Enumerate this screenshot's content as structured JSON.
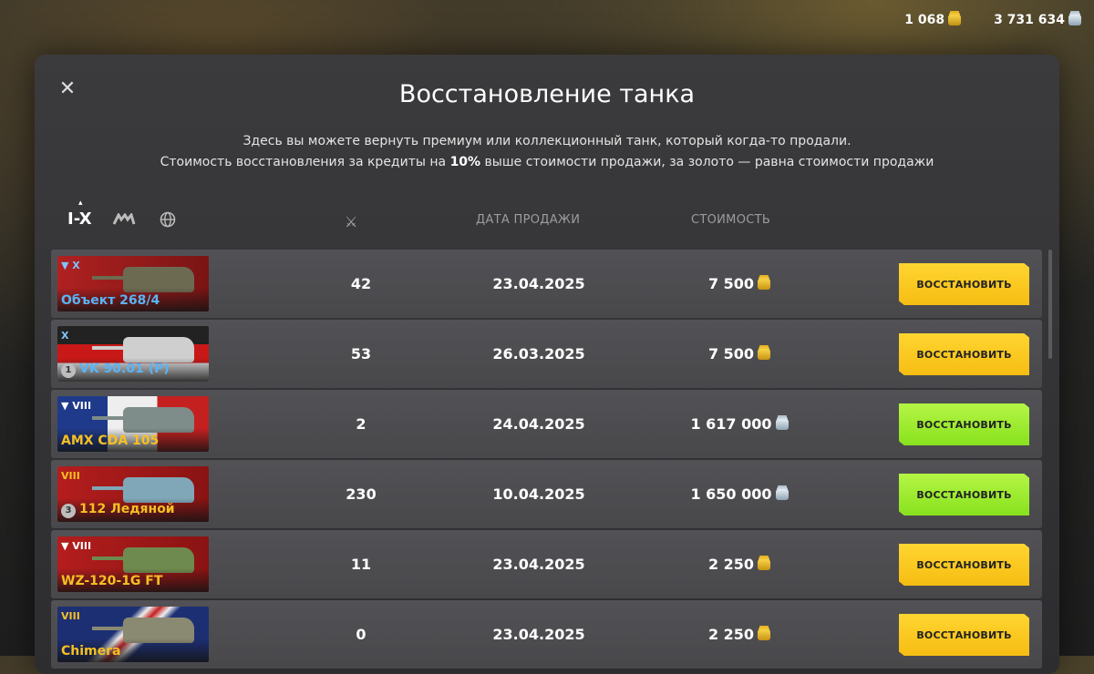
{
  "currency": {
    "gold": "1 068",
    "credits": "3 731 634"
  },
  "dialog": {
    "title": "Восстановление танка",
    "subtitle_line1": "Здесь вы можете вернуть премиум или коллекционный танк, который когда-то продали.",
    "subtitle_line2_pre": "Стоимость восстановления за кредиты на ",
    "subtitle_line2_bold": "10%",
    "subtitle_line2_post": " выше стоимости продажи, за золото — равна стоимости продажи"
  },
  "filters": {
    "tier_label": "I-X"
  },
  "columns": {
    "date": "ДАТА ПРОДАЖИ",
    "price": "СТОИМОСТЬ"
  },
  "colors": {
    "gold_button": "#f6bd12",
    "green_button": "#88e21e",
    "premium_name": "#f5c022",
    "collector_name": "#59b4f6"
  },
  "rows": [
    {
      "tier": "▼ X",
      "name": "Объект 268/4",
      "battles": "42",
      "date": "23.04.2025",
      "price": "7 500",
      "currency": "gold",
      "button": "ВОССТАНОВИТЬ"
    },
    {
      "tier": "X",
      "mastery": "1",
      "name": "VK 90.01 (P)",
      "battles": "53",
      "date": "26.03.2025",
      "price": "7 500",
      "currency": "gold",
      "button": "ВОССТАНОВИТЬ"
    },
    {
      "tier": "▼ VIII",
      "name": "AMX CDA 105",
      "battles": "2",
      "date": "24.04.2025",
      "price": "1 617 000",
      "currency": "credits",
      "button": "ВОССТАНОВИТЬ"
    },
    {
      "tier": "VIII",
      "mastery": "3",
      "name": "112 Ледяной",
      "battles": "230",
      "date": "10.04.2025",
      "price": "1 650 000",
      "currency": "credits",
      "button": "ВОССТАНОВИТЬ"
    },
    {
      "tier": "▼ VIII",
      "name": "WZ-120-1G FT",
      "battles": "11",
      "date": "23.04.2025",
      "price": "2 250",
      "currency": "gold",
      "button": "ВОССТАНОВИТЬ"
    },
    {
      "tier": "VIII",
      "name": "Chimera",
      "battles": "0",
      "date": "23.04.2025",
      "price": "2 250",
      "currency": "gold",
      "button": "ВОССТАНОВИТЬ"
    }
  ]
}
